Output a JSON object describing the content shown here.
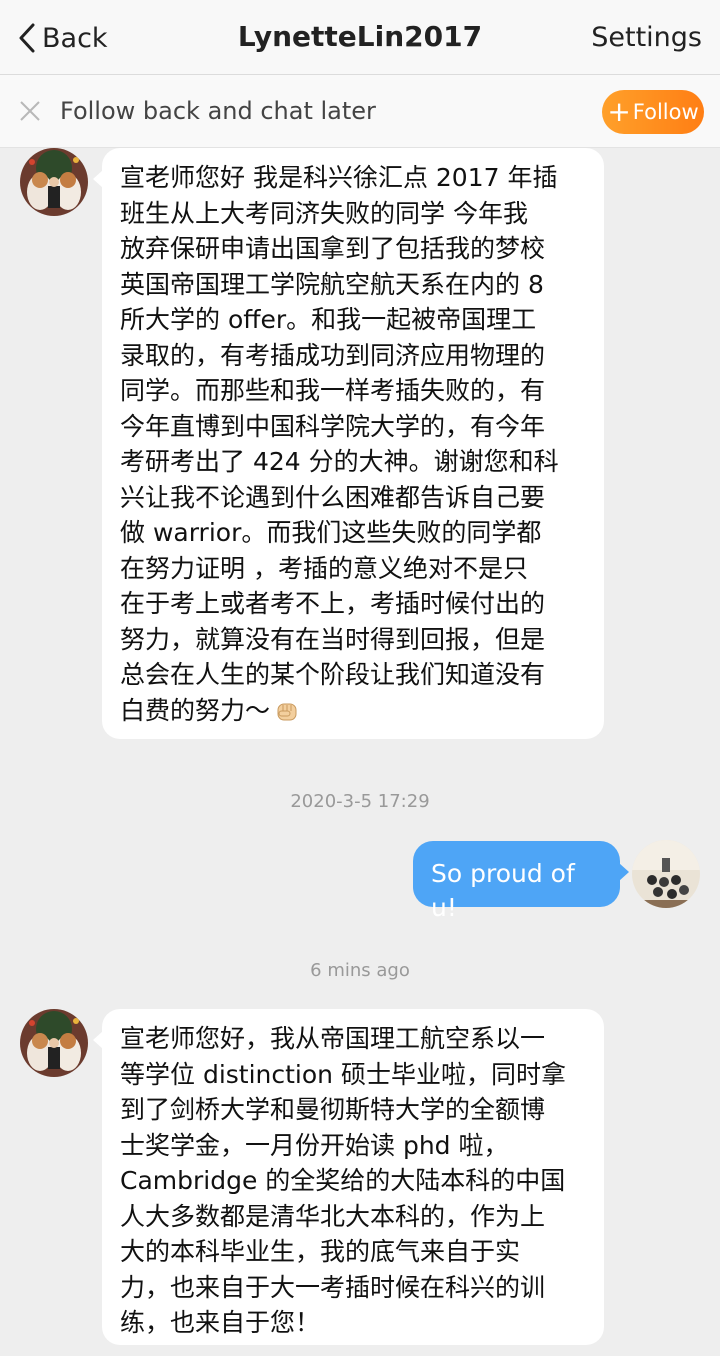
{
  "nav": {
    "back_label": "Back",
    "title": "LynetteLin2017",
    "settings_label": "Settings"
  },
  "follow_bar": {
    "text": "Follow back and chat later",
    "button_label": "Follow"
  },
  "messages": [
    {
      "lines": [
        "宣老师您好 我是科兴徐汇点 2017 年插",
        "班生从上大考同济失败的同学 今年我",
        "放弃保研申请出国拿到了包括我的梦校",
        "英国帝国理工学院航空航天系在内的 8",
        "所大学的 offer。和我一起被帝国理工",
        "录取的，有考插成功到同济应用物理的",
        "同学。而那些和我一样考插失败的，有",
        "今年直博到中国科学院大学的，有今年",
        "考研考出了 424 分的大神。谢谢您和科",
        "兴让我不论遇到什么困难都告诉自己要",
        "做 warrior。而我们这些失败的同学都",
        "在努力证明 ，考插的意义绝对不是只",
        "在于考上或者考不上，考插时候付出的",
        "努力，就算没有在当时得到回报，但是",
        "总会在人生的某个阶段让我们知道没有",
        "白费的努力～"
      ],
      "emoji_icon": "raised-fist-icon"
    },
    {
      "timestamp": "2020-3-5 17:29",
      "text": "So proud of u!"
    },
    {
      "timestamp": "6 mins ago",
      "lines": [
        "宣老师您好，我从帝国理工航空系以一",
        "等学位 distinction 硕士毕业啦，同时拿",
        "到了剑桥大学和曼彻斯特大学的全额博",
        "士奖学金，一月份开始读 phd 啦，",
        "Cambridge 的全奖给的大陆本科的中国",
        "人大多数都是清华北大本科的，作为上",
        "大的本科毕业生，我的底气来自于实",
        "力，也来自于大一考插时候在科兴的训",
        "练，也来自于您！"
      ]
    }
  ],
  "colors": {
    "outgoing_bubble": "#4ea5f6",
    "follow_button": "#ff8c1a"
  }
}
